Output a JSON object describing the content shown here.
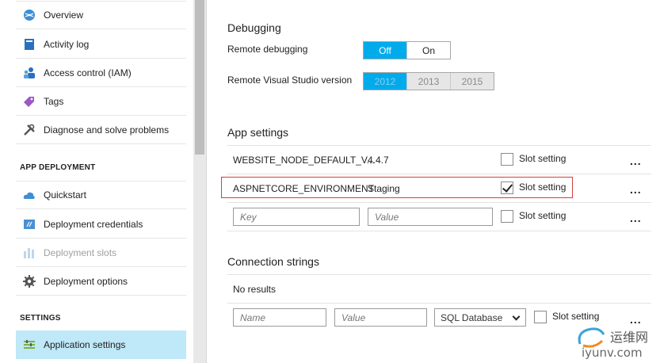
{
  "nav": {
    "items": [
      {
        "label": "Overview",
        "icon": "globe-icon"
      },
      {
        "label": "Activity log",
        "icon": "log-icon"
      },
      {
        "label": "Access control (IAM)",
        "icon": "users-icon"
      },
      {
        "label": "Tags",
        "icon": "tag-icon"
      },
      {
        "label": "Diagnose and solve problems",
        "icon": "wrench-icon"
      }
    ],
    "section_app_deployment": "APP DEPLOYMENT",
    "deploy_items": [
      {
        "label": "Quickstart",
        "icon": "cloud-icon"
      },
      {
        "label": "Deployment credentials",
        "icon": "credentials-icon"
      },
      {
        "label": "Deployment slots",
        "icon": "slots-icon"
      },
      {
        "label": "Deployment options",
        "icon": "gear-icon"
      }
    ],
    "section_settings": "SETTINGS",
    "settings_items": [
      {
        "label": "Application settings",
        "icon": "settings-list-icon"
      }
    ]
  },
  "debugging": {
    "title": "Debugging",
    "remote_debugging_label": "Remote debugging",
    "remote_debugging_options": [
      "Off",
      "On"
    ],
    "remote_debugging_selected": "Off",
    "vs_version_label": "Remote Visual Studio version",
    "vs_versions": [
      "2012",
      "2013",
      "2015"
    ],
    "vs_selected": "2012"
  },
  "app_settings": {
    "title": "App settings",
    "rows": [
      {
        "key": "WEBSITE_NODE_DEFAULT_V...",
        "value": "4.4.7",
        "slot_label": "Slot setting",
        "slot_checked": false
      },
      {
        "key": "ASPNETCORE_ENVIRONMENT",
        "value": "Staging",
        "slot_label": "Slot setting",
        "slot_checked": true
      }
    ],
    "new_row": {
      "key_placeholder": "Key",
      "value_placeholder": "Value",
      "slot_label": "Slot setting"
    },
    "more": "..."
  },
  "connection_strings": {
    "title": "Connection strings",
    "empty_text": "No results",
    "new_row": {
      "name_placeholder": "Name",
      "value_placeholder": "Value",
      "type_selected": "SQL Database",
      "slot_label": "Slot setting"
    },
    "more": "..."
  },
  "watermark": {
    "line1": "运维网",
    "line2": "iyunv.com"
  },
  "colors": {
    "accent": "#00abec",
    "active_nav": "#bfe8f8",
    "highlight_border": "#d43f3a"
  }
}
